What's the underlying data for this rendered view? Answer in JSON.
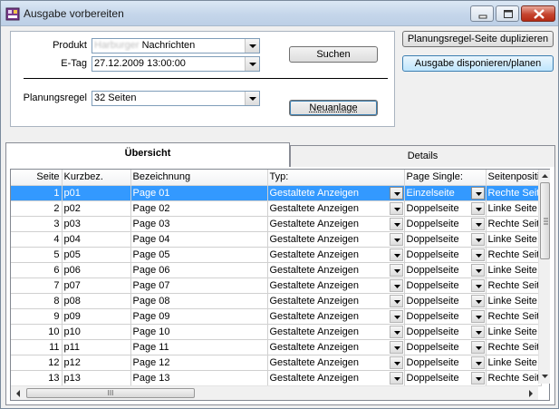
{
  "window": {
    "title": "Ausgabe vorbereiten"
  },
  "form": {
    "produkt_label": "Produkt",
    "produkt_value_redacted": "Harburger",
    "produkt_value": "Nachrichten",
    "etag_label": "E-Tag",
    "etag_value": "27.12.2009 13:00:00",
    "planungsregel_label": "Planungsregel",
    "planungsregel_value": "32 Seiten",
    "suchen_label": "Suchen",
    "neuanlage_label": "Neuanlage"
  },
  "side_buttons": {
    "duplicate_label": "Planungsregel-Seite duplizieren",
    "dispose_label": "Ausgabe disponieren/planen"
  },
  "tabs": [
    {
      "label": "Übersicht",
      "active": true
    },
    {
      "label": "Details",
      "active": false
    }
  ],
  "table": {
    "columns": [
      "Seite",
      "Kurzbez.",
      "Bezeichnung",
      "Typ:",
      "Page Single:",
      "Seitenpositi"
    ],
    "selected_row": 0,
    "rows": [
      {
        "seite": "1",
        "kurz": "p01",
        "bez": "Page 01",
        "typ": "Gestaltete Anzeigen",
        "single": "Einzelseite",
        "pos": "Rechte Seit"
      },
      {
        "seite": "2",
        "kurz": "p02",
        "bez": "Page 02",
        "typ": "Gestaltete Anzeigen",
        "single": "Doppelseite",
        "pos": "Linke Seite"
      },
      {
        "seite": "3",
        "kurz": "p03",
        "bez": "Page 03",
        "typ": "Gestaltete Anzeigen",
        "single": "Doppelseite",
        "pos": "Rechte Seit"
      },
      {
        "seite": "4",
        "kurz": "p04",
        "bez": "Page 04",
        "typ": "Gestaltete Anzeigen",
        "single": "Doppelseite",
        "pos": "Linke Seite"
      },
      {
        "seite": "5",
        "kurz": "p05",
        "bez": "Page 05",
        "typ": "Gestaltete Anzeigen",
        "single": "Doppelseite",
        "pos": "Rechte Seit"
      },
      {
        "seite": "6",
        "kurz": "p06",
        "bez": "Page 06",
        "typ": "Gestaltete Anzeigen",
        "single": "Doppelseite",
        "pos": "Linke Seite"
      },
      {
        "seite": "7",
        "kurz": "p07",
        "bez": "Page 07",
        "typ": "Gestaltete Anzeigen",
        "single": "Doppelseite",
        "pos": "Rechte Seit"
      },
      {
        "seite": "8",
        "kurz": "p08",
        "bez": "Page 08",
        "typ": "Gestaltete Anzeigen",
        "single": "Doppelseite",
        "pos": "Linke Seite"
      },
      {
        "seite": "9",
        "kurz": "p09",
        "bez": "Page 09",
        "typ": "Gestaltete Anzeigen",
        "single": "Doppelseite",
        "pos": "Rechte Seit"
      },
      {
        "seite": "10",
        "kurz": "p10",
        "bez": "Page 10",
        "typ": "Gestaltete Anzeigen",
        "single": "Doppelseite",
        "pos": "Linke Seite"
      },
      {
        "seite": "11",
        "kurz": "p11",
        "bez": "Page 11",
        "typ": "Gestaltete Anzeigen",
        "single": "Doppelseite",
        "pos": "Rechte Seit"
      },
      {
        "seite": "12",
        "kurz": "p12",
        "bez": "Page 12",
        "typ": "Gestaltete Anzeigen",
        "single": "Doppelseite",
        "pos": "Linke Seite"
      },
      {
        "seite": "13",
        "kurz": "p13",
        "bez": "Page 13",
        "typ": "Gestaltete Anzeigen",
        "single": "Doppelseite",
        "pos": "Rechte Seit"
      }
    ]
  },
  "scroll": {
    "h_thumb_grip": "III"
  },
  "colors": {
    "selection": "#3399ff",
    "titlebar": "#c5d6ea"
  },
  "icons": [
    "app-icon",
    "minimize-icon",
    "maximize-icon",
    "close-icon",
    "chevron-down-icon"
  ]
}
